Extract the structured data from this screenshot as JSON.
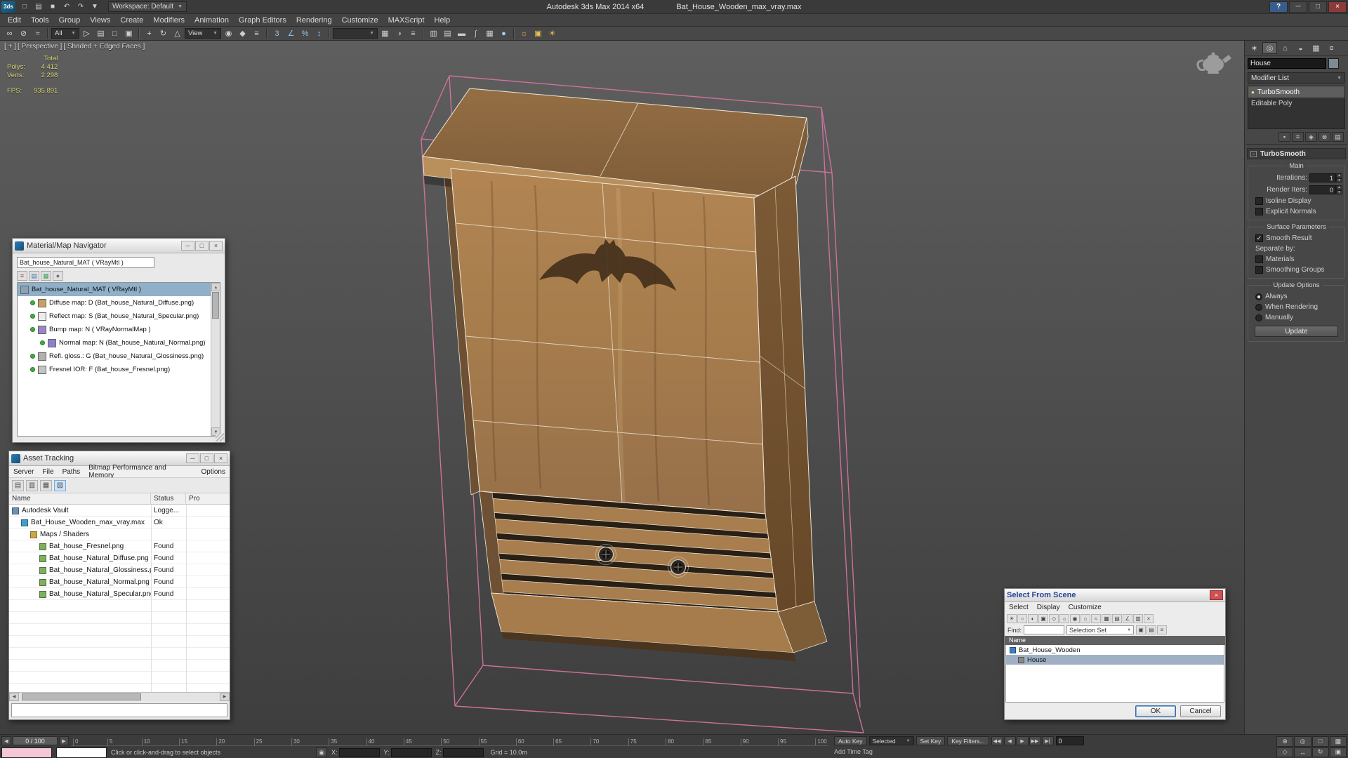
{
  "colors": {
    "pink": "#d4739f",
    "wire": "#efe8d6",
    "bat": "#43301c",
    "wood-light": "#b9905c",
    "wood-mid": "#a67c4c",
    "wood-dark": "#7d5c38",
    "wood-side": "#6e5134",
    "slat": "#a87e4e",
    "slat-gap": "#2a1f14",
    "panel": "#474747",
    "sel-blue": "#8fb0c8"
  },
  "title_bar": {
    "logo": "3ds",
    "title": "Autodesk 3ds Max 2014 x64",
    "file": "Bat_House_Wooden_max_vray.max",
    "workspace_label": "Workspace: Default",
    "workspace_arrow": "▼",
    "qat_icons": [
      {
        "name": "new-scene-icon",
        "glyph": "□"
      },
      {
        "name": "open-file-icon",
        "glyph": "▤"
      },
      {
        "name": "save-file-icon",
        "glyph": "■"
      },
      {
        "name": "undo-icon",
        "glyph": "↶"
      },
      {
        "name": "redo-icon",
        "glyph": "↷"
      },
      {
        "name": "project-folder-icon",
        "glyph": "▼"
      }
    ],
    "help": "?",
    "minimize": "─",
    "maximize": "□",
    "close": "×"
  },
  "menu_bar": {
    "items": [
      {
        "name": "menu-edit",
        "label": "Edit"
      },
      {
        "name": "menu-tools",
        "label": "Tools"
      },
      {
        "name": "menu-group",
        "label": "Group"
      },
      {
        "name": "menu-views",
        "label": "Views"
      },
      {
        "name": "menu-create",
        "label": "Create"
      },
      {
        "name": "menu-modifiers",
        "label": "Modifiers"
      },
      {
        "name": "menu-animation",
        "label": "Animation"
      },
      {
        "name": "menu-graph-editors",
        "label": "Graph Editors"
      },
      {
        "name": "menu-rendering",
        "label": "Rendering"
      },
      {
        "name": "menu-customize",
        "label": "Customize"
      },
      {
        "name": "menu-maxscript",
        "label": "MAXScript"
      },
      {
        "name": "menu-help",
        "label": "Help"
      }
    ]
  },
  "toolbar": {
    "items": [
      {
        "name": "select-and-link-icon",
        "glyph": "∞"
      },
      {
        "name": "unlink-selection-icon",
        "glyph": "⊘"
      },
      {
        "name": "bind-to-space-warp-icon",
        "glyph": "≈"
      },
      {
        "name": "toolbar-separator",
        "sep": true
      },
      {
        "name": "selection-filter-dropdown",
        "label": "All"
      },
      {
        "name": "select-object-icon",
        "glyph": "▷",
        "color": "#e8e8e8"
      },
      {
        "name": "select-by-name-icon",
        "glyph": "▤"
      },
      {
        "name": "rectangular-selection-region-icon",
        "glyph": "□"
      },
      {
        "name": "window-crossing-icon",
        "glyph": "▣"
      },
      {
        "name": "toolbar-separator",
        "sep": true
      },
      {
        "name": "select-and-move-icon",
        "glyph": "+",
        "color": "#e0e0e0"
      },
      {
        "name": "select-and-rotate-icon",
        "glyph": "↻"
      },
      {
        "name": "select-and-scale-icon",
        "glyph": "△"
      },
      {
        "name": "reference-coordinate-dropdown",
        "label": "View"
      },
      {
        "name": "use-pivot-point-icon",
        "glyph": "◉"
      },
      {
        "name": "select-and-manipulate-icon",
        "glyph": "◆"
      },
      {
        "name": "keyboard-shortcut-override-icon",
        "glyph": "≡"
      },
      {
        "name": "toolbar-separator",
        "sep": true
      },
      {
        "name": "snap-toggle-3d-icon",
        "glyph": "3",
        "color": "#8fc2e8"
      },
      {
        "name": "angle-snap-icon",
        "glyph": "∠",
        "color": "#8fc2e8"
      },
      {
        "name": "percent-snap-icon",
        "glyph": "%",
        "color": "#8fc2e8"
      },
      {
        "name": "spinner-snap-icon",
        "glyph": "↕",
        "color": "#8fc2e8"
      },
      {
        "name": "toolbar-separator",
        "sep": true
      },
      {
        "name": "named-selection-combo",
        "label": " "
      },
      {
        "name": "edit-named-selections-icon",
        "glyph": "▦"
      },
      {
        "name": "mirror-icon",
        "glyph": "◑",
        "color": "#c8a0c8"
      },
      {
        "name": "align-icon",
        "glyph": "≡"
      },
      {
        "name": "toolbar-separator",
        "sep": true
      },
      {
        "name": "toggle-scene-explorer-icon",
        "glyph": "▥"
      },
      {
        "name": "toggle-layer-explorer-icon",
        "glyph": "▤"
      },
      {
        "name": "toggle-ribbon-icon",
        "glyph": "▬"
      },
      {
        "name": "curve-editor-icon",
        "glyph": "∫",
        "color": "#9fd09f"
      },
      {
        "name": "schematic-view-icon",
        "glyph": "▦"
      },
      {
        "name": "material-editor-icon",
        "glyph": "●",
        "color": "#9fd0ff"
      },
      {
        "name": "toolbar-separator",
        "sep": true
      },
      {
        "name": "render-setup-icon",
        "glyph": "☼",
        "color": "#e8c050"
      },
      {
        "name": "rendered-frame-window-icon",
        "glyph": "▣",
        "color": "#e8c050"
      },
      {
        "name": "render-production-icon",
        "glyph": "☀",
        "color": "#e8c050"
      }
    ]
  },
  "viewport": {
    "menus": [
      {
        "name": "viewport-general-menu",
        "label": "[ + ]"
      },
      {
        "name": "viewport-pov-menu",
        "label": "[ Perspective ]"
      },
      {
        "name": "viewport-shading-menu",
        "label": "[ Shaded + Edged Faces ]"
      }
    ],
    "stats": {
      "total_header": "Total",
      "polys_label": "Polys:",
      "polys_value": "4 412",
      "verts_label": "Verts:",
      "verts_value": "2 298",
      "fps_label": "FPS:",
      "fps_value": "935.891"
    }
  },
  "material_navigator": {
    "title": "Material/Map Navigator",
    "field_value": "Bat_house_Natural_MAT ( VRayMtl )",
    "minimize": "─",
    "maximize": "□",
    "close": "×",
    "view_icons": [
      {
        "name": "view-text-list-icon",
        "glyph": "≡",
        "color": "#b04040"
      },
      {
        "name": "view-small-icons-icon",
        "glyph": "▤",
        "color": "#4070b0"
      },
      {
        "name": "view-large-icons-icon",
        "glyph": "▦",
        "color": "#40a060"
      },
      {
        "name": "view-sample-slots-icon",
        "glyph": "●",
        "color": "#707070"
      }
    ],
    "items": [
      {
        "name": "matnav-item-material",
        "label": "Bat_house_Natural_MAT ( VRayMtl )",
        "swatch": "#8aa2b4",
        "level": 0,
        "selected": true
      },
      {
        "name": "matnav-item-diffuse",
        "label": "Diffuse map: D (Bat_house_Natural_Diffuse.png)",
        "swatch": "#c8a064",
        "level": 1,
        "green": true
      },
      {
        "name": "matnav-item-reflect",
        "label": "Reflect map: S (Bat_house_Natural_Specular.png)",
        "swatch": "#ececec",
        "level": 1,
        "green": true
      },
      {
        "name": "matnav-item-bump",
        "label": "Bump map: N ( VRayNormalMap )",
        "swatch": "#9a86c8",
        "level": 1,
        "green": true
      },
      {
        "name": "matnav-item-normal",
        "label": "Normal map: N (Bat_house_Natural_Normal.png)",
        "swatch": "#8f7fd0",
        "level": 2,
        "green": true
      },
      {
        "name": "matnav-item-glossiness",
        "label": "Refl. gloss.: G (Bat_house_Natural_Glossiness.png)",
        "swatch": "#b0b0b0",
        "level": 1,
        "green": true
      },
      {
        "name": "matnav-item-fresnel",
        "label": "Fresnel IOR: F (Bat_house_Fresnel.png)",
        "swatch": "#c4c4c4",
        "level": 1,
        "green": true
      }
    ]
  },
  "asset_tracking": {
    "title": "Asset Tracking",
    "minimize": "─",
    "maximize": "□",
    "close": "×",
    "menus": [
      {
        "name": "at-menu-server",
        "label": "Server"
      },
      {
        "name": "at-menu-file",
        "label": "File"
      },
      {
        "name": "at-menu-paths",
        "label": "Paths"
      },
      {
        "name": "at-menu-bitmap",
        "label": "Bitmap Performance and Memory"
      },
      {
        "name": "at-menu-options",
        "label": "Options"
      }
    ],
    "toolbar_icons": [
      {
        "name": "at-status-view-icon",
        "glyph": "▤"
      },
      {
        "name": "at-refresh-icon",
        "glyph": "▥"
      },
      {
        "name": "at-list-view-icon",
        "glyph": "▦"
      },
      {
        "name": "at-table-view-icon",
        "glyph": "▧",
        "selected": true
      }
    ],
    "columns": [
      "Name",
      "Status",
      "Pro"
    ],
    "rows": [
      {
        "name": "asset-row-vault",
        "label": "Autodesk Vault",
        "status": "Logge...",
        "level": 0,
        "icon_color": "#6f8fb4"
      },
      {
        "name": "asset-row-max-file",
        "label": "Bat_House_Wooden_max_vray.max",
        "status": "Ok",
        "level": 1,
        "icon_color": "#3fa0c8"
      },
      {
        "name": "asset-row-maps-shaders",
        "label": "Maps / Shaders",
        "status": "",
        "level": 2,
        "icon_color": "#c8a83f"
      },
      {
        "name": "asset-row-fresnel",
        "label": "Bat_house_Fresnel.png",
        "status": "Found",
        "level": 3,
        "icon_color": "#7fae5f"
      },
      {
        "name": "asset-row-diffuse",
        "label": "Bat_house_Natural_Diffuse.png",
        "status": "Found",
        "level": 3,
        "icon_color": "#7fae5f"
      },
      {
        "name": "asset-row-glossiness",
        "label": "Bat_house_Natural_Glossiness.png",
        "status": "Found",
        "level": 3,
        "icon_color": "#7fae5f"
      },
      {
        "name": "asset-row-normal",
        "label": "Bat_house_Natural_Normal.png",
        "status": "Found",
        "level": 3,
        "icon_color": "#7fae5f"
      },
      {
        "name": "asset-row-specular",
        "label": "Bat_house_Natural_Specular.png",
        "status": "Found",
        "level": 3,
        "icon_color": "#7fae5f"
      }
    ]
  },
  "select_from_scene": {
    "title": "Select From Scene",
    "close": "×",
    "menus": [
      {
        "name": "sfs-menu-select",
        "label": "Select"
      },
      {
        "name": "sfs-menu-display",
        "label": "Display"
      },
      {
        "name": "sfs-menu-customize",
        "label": "Customize"
      }
    ],
    "toolbar_icons": [
      {
        "name": "display-all-icon",
        "glyph": "☀"
      },
      {
        "name": "display-none-icon",
        "glyph": "○"
      },
      {
        "name": "display-invert-icon",
        "glyph": "◐"
      },
      {
        "name": "display-geometry-icon",
        "glyph": "▣"
      },
      {
        "name": "display-shapes-icon",
        "glyph": "◇"
      },
      {
        "name": "display-lights-icon",
        "glyph": "☼"
      },
      {
        "name": "display-cameras-icon",
        "glyph": "◉"
      },
      {
        "name": "display-helpers-icon",
        "glyph": "⌂"
      },
      {
        "name": "display-spacewarps-icon",
        "glyph": "≈"
      },
      {
        "name": "display-groups-icon",
        "glyph": "▦"
      },
      {
        "name": "display-xrefs-icon",
        "glyph": "▤"
      },
      {
        "name": "display-bones-icon",
        "glyph": "∠"
      },
      {
        "name": "display-containers-icon",
        "glyph": "▥"
      },
      {
        "name": "display-frozen-icon",
        "glyph": "×"
      }
    ],
    "find_label": "Find:",
    "find_value": "",
    "combo_label": "Selection Set",
    "combo_arrow": "▼",
    "combo_icons": [
      {
        "name": "sfs-select-icon",
        "glyph": "▣"
      },
      {
        "name": "sfs-lock-icon",
        "glyph": "▤"
      },
      {
        "name": "sfs-settings-icon",
        "glyph": "≡"
      }
    ],
    "header": "Name",
    "rows": [
      {
        "name": "scene-row-bat-house-wooden",
        "label": "Bat_House_Wooden",
        "level": 0,
        "icon_color": "#3f7fbf"
      },
      {
        "name": "scene-row-house",
        "label": "House",
        "level": 1,
        "icon_color": "#8a8a8a",
        "selected": true
      }
    ],
    "ok": "OK",
    "cancel": "Cancel"
  },
  "command_panel": {
    "tabs": [
      {
        "name": "create-tab-icon",
        "glyph": "∗"
      },
      {
        "name": "modify-tab-icon",
        "glyph": "◎",
        "selected": true
      },
      {
        "name": "hierarchy-tab-icon",
        "glyph": "⌂"
      },
      {
        "name": "motion-tab-icon",
        "glyph": "◒"
      },
      {
        "name": "display-tab-icon",
        "glyph": "▦"
      },
      {
        "name": "utilities-tab-icon",
        "glyph": "¤"
      }
    ],
    "object_name": "House",
    "modifier_list_label": "Modifier List",
    "modifier_list_arrow": "▼",
    "stack": [
      {
        "name": "stack-item-turbosmooth",
        "label": "TurboSmooth",
        "selected": true,
        "bulb": true
      },
      {
        "name": "stack-item-editable-poly",
        "label": "Editable Poly"
      }
    ],
    "stack_icons": [
      {
        "name": "pin-stack-icon",
        "glyph": "▪"
      },
      {
        "name": "show-end-result-icon",
        "glyph": "≡"
      },
      {
        "name": "make-unique-icon",
        "glyph": "◈"
      },
      {
        "name": "remove-modifier-icon",
        "glyph": "⊗"
      },
      {
        "name": "configure-modifier-sets-icon",
        "glyph": "▤"
      }
    ],
    "rollout_title": "TurboSmooth",
    "rollout_collapse": "−",
    "groups": {
      "main_label": "Main",
      "iterations_label": "Iterations:",
      "iterations_value": "1",
      "render_iters_label": "Render Iters:",
      "render_iters_value": "0",
      "isoline": "Isoline Display",
      "explicit": "Explicit Normals",
      "surface_label": "Surface Parameters",
      "smooth_result": "Smooth Result",
      "separate_by": "Separate by:",
      "materials": "Materials",
      "smoothing_groups": "Smoothing Groups",
      "update_label": "Update Options",
      "always": "Always",
      "when_rendering": "When Rendering",
      "manually": "Manually",
      "update_button": "Update"
    }
  },
  "timeline": {
    "prev": "◀",
    "next": "▶",
    "slider_label": "0 / 100",
    "ticks": [
      "0",
      "5",
      "10",
      "15",
      "20",
      "25",
      "30",
      "35",
      "40",
      "45",
      "50",
      "55",
      "60",
      "65",
      "70",
      "75",
      "80",
      "85",
      "90",
      "95",
      "100"
    ]
  },
  "status_bar": {
    "prompt": "Click or click-and-drag to select objects",
    "lock_glyph": "◉",
    "x_label": "X:",
    "x_value": "",
    "y_label": "Y:",
    "y_value": "",
    "z_label": "Z:",
    "z_value": "",
    "grid_label": "Grid = 10.0m",
    "auto_key": "Auto Key",
    "selected_combo": "Selected",
    "set_key": "Set Key",
    "key_filters": "Key Filters...",
    "frame_value": "0",
    "add_time_tag": "Add Time Tag",
    "playback": [
      {
        "name": "go-to-start-icon",
        "glyph": "◀◀"
      },
      {
        "name": "previous-frame-icon",
        "glyph": "◀"
      },
      {
        "name": "play-icon",
        "glyph": "▶"
      },
      {
        "name": "next-frame-icon",
        "glyph": "▶▶"
      },
      {
        "name": "go-to-end-icon",
        "glyph": "▶|"
      }
    ],
    "nav_icons": [
      {
        "name": "zoom-icon",
        "glyph": "⊕"
      },
      {
        "name": "zoom-all-icon",
        "glyph": "◎"
      },
      {
        "name": "zoom-extents-icon",
        "glyph": "□"
      },
      {
        "name": "zoom-extents-all-icon",
        "glyph": "▦"
      },
      {
        "name": "field-of-view-icon",
        "glyph": "◇"
      },
      {
        "name": "pan-icon",
        "glyph": "↔"
      },
      {
        "name": "orbit-icon",
        "glyph": "↻"
      },
      {
        "name": "maximize-viewport-icon",
        "glyph": "▣"
      }
    ]
  }
}
